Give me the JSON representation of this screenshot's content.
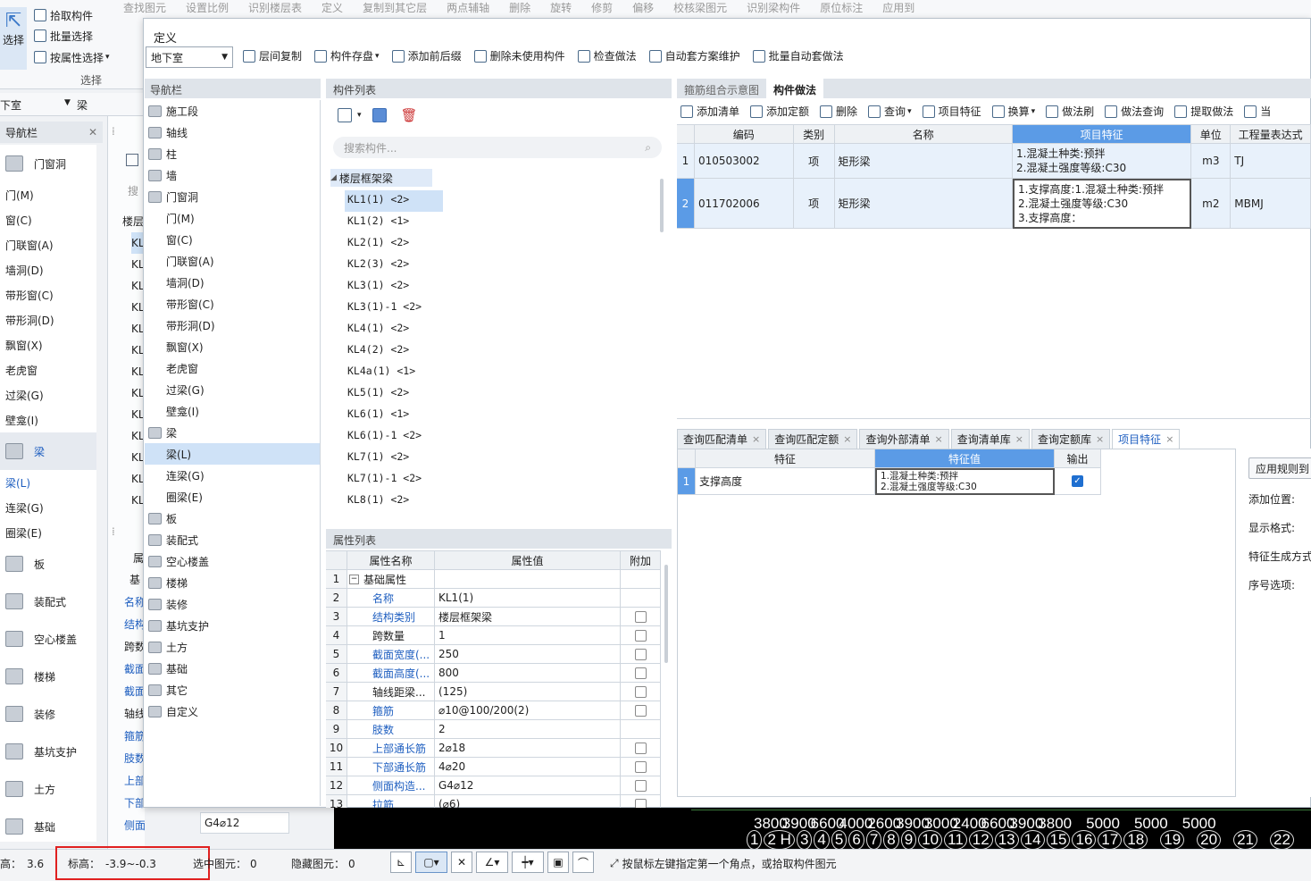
{
  "ribbon": {
    "top_items": [
      "查找图元",
      "设置比例",
      "识别楼层表",
      "定义",
      "复制到其它层",
      "两点辅轴",
      "删除",
      "旋转",
      "修剪",
      "偏移",
      "校核梁图元",
      "识别梁构件",
      "原位标注",
      "应用到"
    ],
    "select_group": {
      "big_label": "选择",
      "pick": "拾取构件",
      "batch": "批量选择",
      "by_attr": "按属性选择",
      "group_label": "选择"
    }
  },
  "left": {
    "floor": "下室",
    "type_label": "梁",
    "nav_title": "导航栏",
    "items": [
      "门窗洞",
      "门(M)",
      "窗(C)",
      "门联窗(A)",
      "墙洞(D)",
      "带形窗(C)",
      "带形洞(D)",
      "飘窗(X)",
      "老虎窗",
      "过梁(G)",
      "壁龛(I)",
      "梁",
      "梁(L)",
      "连梁(G)",
      "圈梁(E)",
      "板",
      "装配式",
      "空心楼盖",
      "楼梯",
      "装修",
      "基坑支护",
      "土方",
      "基础"
    ]
  },
  "second_col": {
    "search": "搜",
    "group": "楼层",
    "kl_prefix": "KL",
    "attr_rows": [
      "名称",
      "结构",
      "跨数",
      "截面",
      "截面",
      "轴线",
      "箍筋",
      "肢数",
      "上部",
      "下部",
      "侧面构造或..."
    ],
    "attr_value": "G4⌀12",
    "props_head": "属",
    "base": "基"
  },
  "define": {
    "title": "定义",
    "floor": "地下室",
    "toolbar": [
      "层间复制",
      "构件存盘",
      "添加前后缀",
      "删除未使用构件",
      "检查做法",
      "自动套方案维护",
      "批量自动套做法"
    ]
  },
  "nav": {
    "title": "导航栏",
    "items": [
      "施工段",
      "轴线",
      "柱",
      "墙",
      "门窗洞",
      "门(M)",
      "窗(C)",
      "门联窗(A)",
      "墙洞(D)",
      "带形窗(C)",
      "带形洞(D)",
      "飘窗(X)",
      "老虎窗",
      "过梁(G)",
      "壁龛(I)",
      "梁",
      "梁(L)",
      "连梁(G)",
      "圈梁(E)",
      "板",
      "装配式",
      "空心楼盖",
      "楼梯",
      "装修",
      "基坑支护",
      "土方",
      "基础",
      "其它",
      "自定义"
    ],
    "selected": "梁(L)"
  },
  "components": {
    "title": "构件列表",
    "search_placeholder": "搜索构件...",
    "group": "楼层框架梁",
    "items": [
      "KL1(1) <2>",
      "KL1(2) <1>",
      "KL2(1) <2>",
      "KL2(3) <2>",
      "KL3(1) <2>",
      "KL3(1)-1 <2>",
      "KL4(1) <2>",
      "KL4(2) <2>",
      "KL4a(1) <1>",
      "KL5(1) <2>",
      "KL6(1) <1>",
      "KL6(1)-1 <2>",
      "KL7(1) <2>",
      "KL7(1)-1 <2>",
      "KL8(1) <2>"
    ],
    "selected": "KL1(1) <2>"
  },
  "props": {
    "title": "属性列表",
    "headers": [
      "属性名称",
      "属性值",
      "附加"
    ],
    "rows": [
      {
        "n": "1",
        "name": "基础属性",
        "value": "",
        "chk": false,
        "group": true
      },
      {
        "n": "2",
        "name": "名称",
        "value": "KL1(1)",
        "chk": false,
        "link": true
      },
      {
        "n": "3",
        "name": "结构类别",
        "value": "楼层框架梁",
        "chk": true,
        "link": true
      },
      {
        "n": "4",
        "name": "跨数量",
        "value": "1",
        "chk": true,
        "link": false
      },
      {
        "n": "5",
        "name": "截面宽度(...",
        "value": "250",
        "chk": true,
        "link": true
      },
      {
        "n": "6",
        "name": "截面高度(...",
        "value": "800",
        "chk": true,
        "link": true
      },
      {
        "n": "7",
        "name": "轴线距梁...",
        "value": "(125)",
        "chk": true,
        "link": false
      },
      {
        "n": "8",
        "name": "箍筋",
        "value": "⌀10@100/200(2)",
        "chk": true,
        "link": true
      },
      {
        "n": "9",
        "name": "肢数",
        "value": "2",
        "chk": false,
        "link": true
      },
      {
        "n": "10",
        "name": "上部通长筋",
        "value": "2⌀18",
        "chk": true,
        "link": true
      },
      {
        "n": "11",
        "name": "下部通长筋",
        "value": "4⌀20",
        "chk": true,
        "link": true
      },
      {
        "n": "12",
        "name": "侧面构造...",
        "value": "G4⌀12",
        "chk": true,
        "link": true
      },
      {
        "n": "13",
        "name": "拉筋",
        "value": "(⌀6)",
        "chk": true,
        "link": true
      }
    ]
  },
  "method": {
    "tabs": [
      "箍筋组合示意图",
      "构件做法"
    ],
    "toolbar": [
      "添加清单",
      "添加定额",
      "删除",
      "查询",
      "项目特征",
      "换算",
      "做法刷",
      "做法查询",
      "提取做法",
      "当"
    ],
    "headers": [
      "编码",
      "类别",
      "名称",
      "项目特征",
      "单位",
      "工程量表达式"
    ],
    "rows": [
      {
        "n": "1",
        "code": "010503002",
        "type": "项",
        "name": "矩形梁",
        "feature": [
          "1.混凝土种类:预拌",
          "2.混凝土强度等级:C30"
        ],
        "unit": "m3",
        "expr": "TJ"
      },
      {
        "n": "2",
        "code": "011702006",
        "type": "项",
        "name": "矩形梁",
        "feature": [
          "1.支撑高度:1.混凝土种类:预拌",
          "2.混凝土强度等级:C30",
          "3.支撑高度："
        ],
        "unit": "m2",
        "expr": "MBMJ"
      }
    ]
  },
  "query": {
    "tabs": [
      "查询匹配清单",
      "查询匹配定额",
      "查询外部清单",
      "查询清单库",
      "查询定额库",
      "项目特征"
    ],
    "headers": [
      "特征",
      "特征值",
      "输出"
    ],
    "row": {
      "n": "1",
      "feature": "支撑高度",
      "value": [
        "1.混凝土种类:预拌",
        "2.混凝土强度等级:C30"
      ],
      "output": true
    },
    "side": [
      "应用规则到",
      "添加位置:",
      "显示格式:",
      "特征生成方式",
      "序号选项:"
    ]
  },
  "canvas": {
    "dims": [
      "3800",
      "3900",
      "6600",
      "4000",
      "2600",
      "3900",
      "3000",
      "2400",
      "6600",
      "3900",
      "3800",
      "5000",
      "5000",
      "5000"
    ],
    "axes": [
      "1",
      "2 H",
      "3",
      "4",
      "5",
      "6",
      "7",
      "8",
      "9",
      "10",
      "11",
      "12",
      "13",
      "14",
      "15",
      "16",
      "17",
      "18",
      "19",
      "20",
      "21",
      "22"
    ]
  },
  "status": {
    "height_label": "高：",
    "height": "3.6",
    "elev_label": "标高：",
    "elev": "-3.9~-0.3",
    "sel_label": "选中图元：",
    "sel": "0",
    "hide_label": "隐藏图元：",
    "hide": "0",
    "hint": "按鼠标左键指定第一个角点，或拾取构件图元"
  }
}
